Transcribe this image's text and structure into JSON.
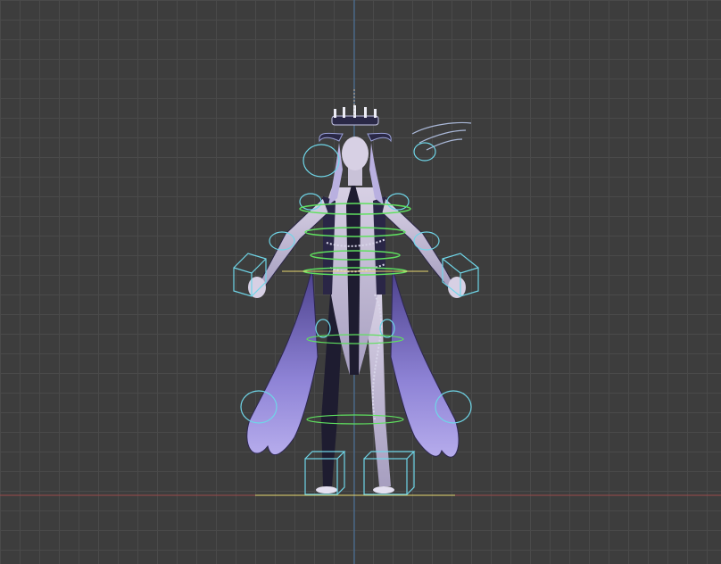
{
  "viewport": {
    "colors": {
      "background": "#3d3d3d",
      "grid": "#4a4a4a",
      "axis_x": "#9a4a4a",
      "axis_y": "#4a78a8",
      "rig_cyan": "#6fd6e8",
      "rig_green": "#5fe05f",
      "rig_yellow": "#e8d870",
      "cloth": "#7d72c8",
      "skin": "#c9c2d8",
      "dark_suit": "#1e1c30"
    },
    "icons": [
      "character-model",
      "ik-foot-box-control",
      "ik-hand-control",
      "spine-ring-control"
    ]
  }
}
